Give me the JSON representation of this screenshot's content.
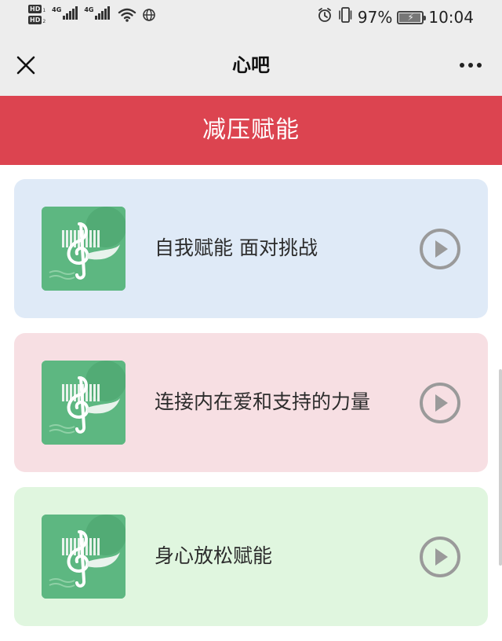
{
  "status_bar": {
    "hd1": "HD",
    "hd1_sub": "1",
    "hd2": "HD",
    "hd2_sub": "2",
    "network1": "4G",
    "network2": "4G",
    "battery_percent": "97%",
    "battery_level": 0.97,
    "time": "10:04",
    "icons": [
      "signal-icon",
      "wifi-icon",
      "globe-icon",
      "alarm-icon",
      "vibrate-icon",
      "battery-icon"
    ]
  },
  "nav": {
    "title": "心吧",
    "close_icon": "close-icon",
    "more_icon": "more-icon"
  },
  "banner": {
    "title": "减压赋能",
    "color": "#dc4450"
  },
  "cards": [
    {
      "title": "自我赋能 面对挑战",
      "background": "#dfeaf7",
      "icon": "play-icon"
    },
    {
      "title": "连接内在爱和支持的力量",
      "background": "#f7dfe3",
      "icon": "play-icon"
    },
    {
      "title": "身心放松赋能",
      "background": "#e0f6df",
      "icon": "play-icon"
    }
  ],
  "colors": {
    "header_bg": "#ededed",
    "thumb_green": "#5db781",
    "play_gray": "#9a9a9a"
  }
}
